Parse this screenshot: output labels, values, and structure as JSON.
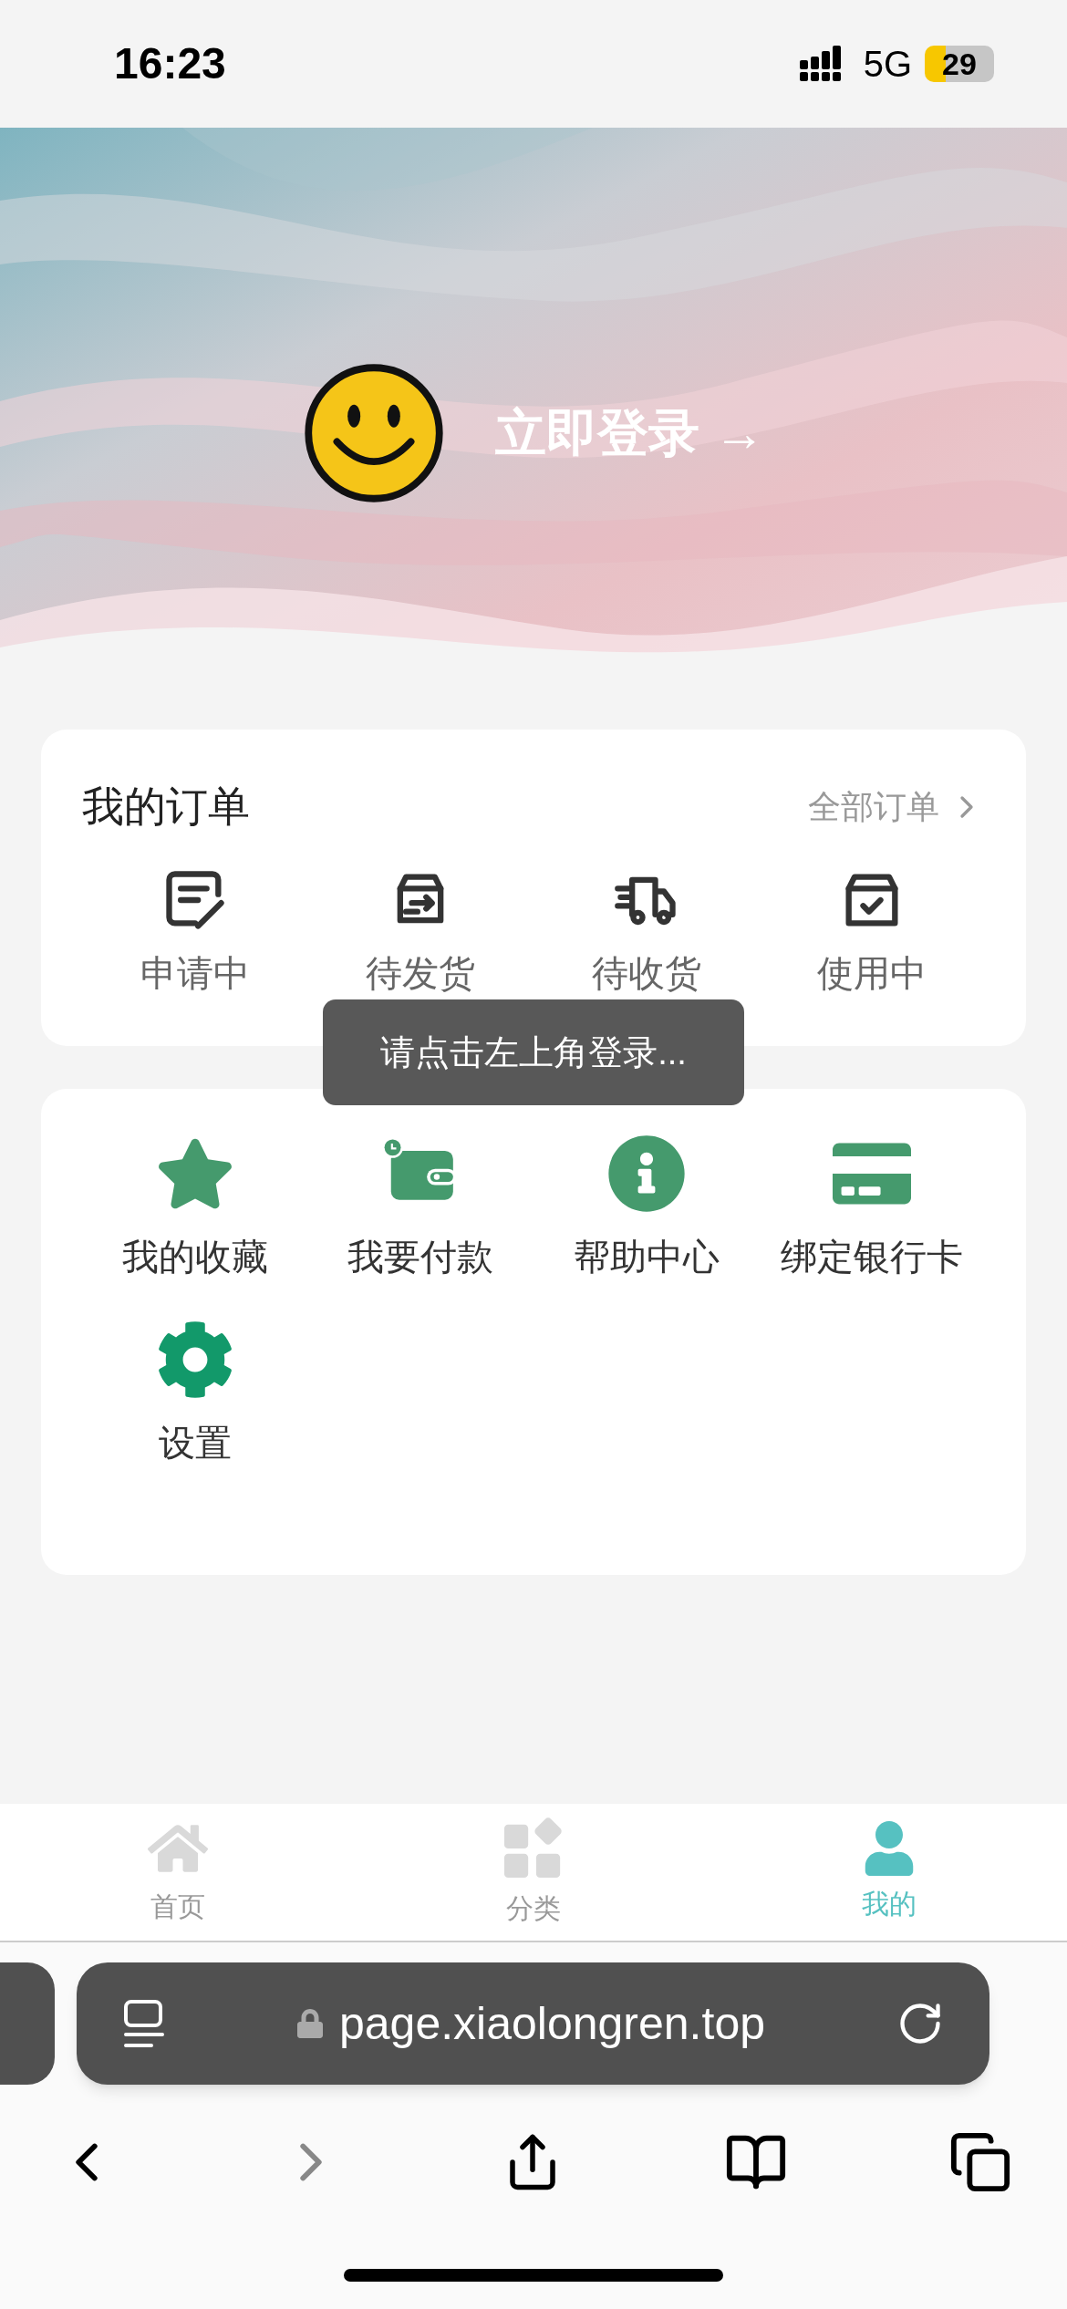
{
  "status_bar": {
    "time": "16:23",
    "network": "5G",
    "battery": "29"
  },
  "hero": {
    "kind": "picture",
    "login_label": "立即登录 →"
  },
  "orders": {
    "title": "我的订单",
    "all_link": "全部订单",
    "items": [
      {
        "kind": "applying",
        "label": "申请中"
      },
      {
        "kind": "to_ship",
        "label": "待发货"
      },
      {
        "kind": "to_receive",
        "label": "待收货"
      },
      {
        "kind": "in_use",
        "label": "使用中"
      }
    ]
  },
  "toast": "请点击左上角登录...",
  "services": [
    {
      "kind": "favorites",
      "label": "我的收藏"
    },
    {
      "kind": "pay",
      "label": "我要付款"
    },
    {
      "kind": "help",
      "label": "帮助中心"
    },
    {
      "kind": "bank_card",
      "label": "绑定银行卡"
    },
    {
      "kind": "settings",
      "label": "设置"
    }
  ],
  "tab_bar": [
    {
      "kind": "home",
      "label": "首页",
      "selected": false
    },
    {
      "kind": "category",
      "label": "分类",
      "selected": false
    },
    {
      "kind": "mine",
      "label": "我的",
      "selected": true
    }
  ],
  "browser": {
    "url": "page.xiaolongren.top"
  }
}
